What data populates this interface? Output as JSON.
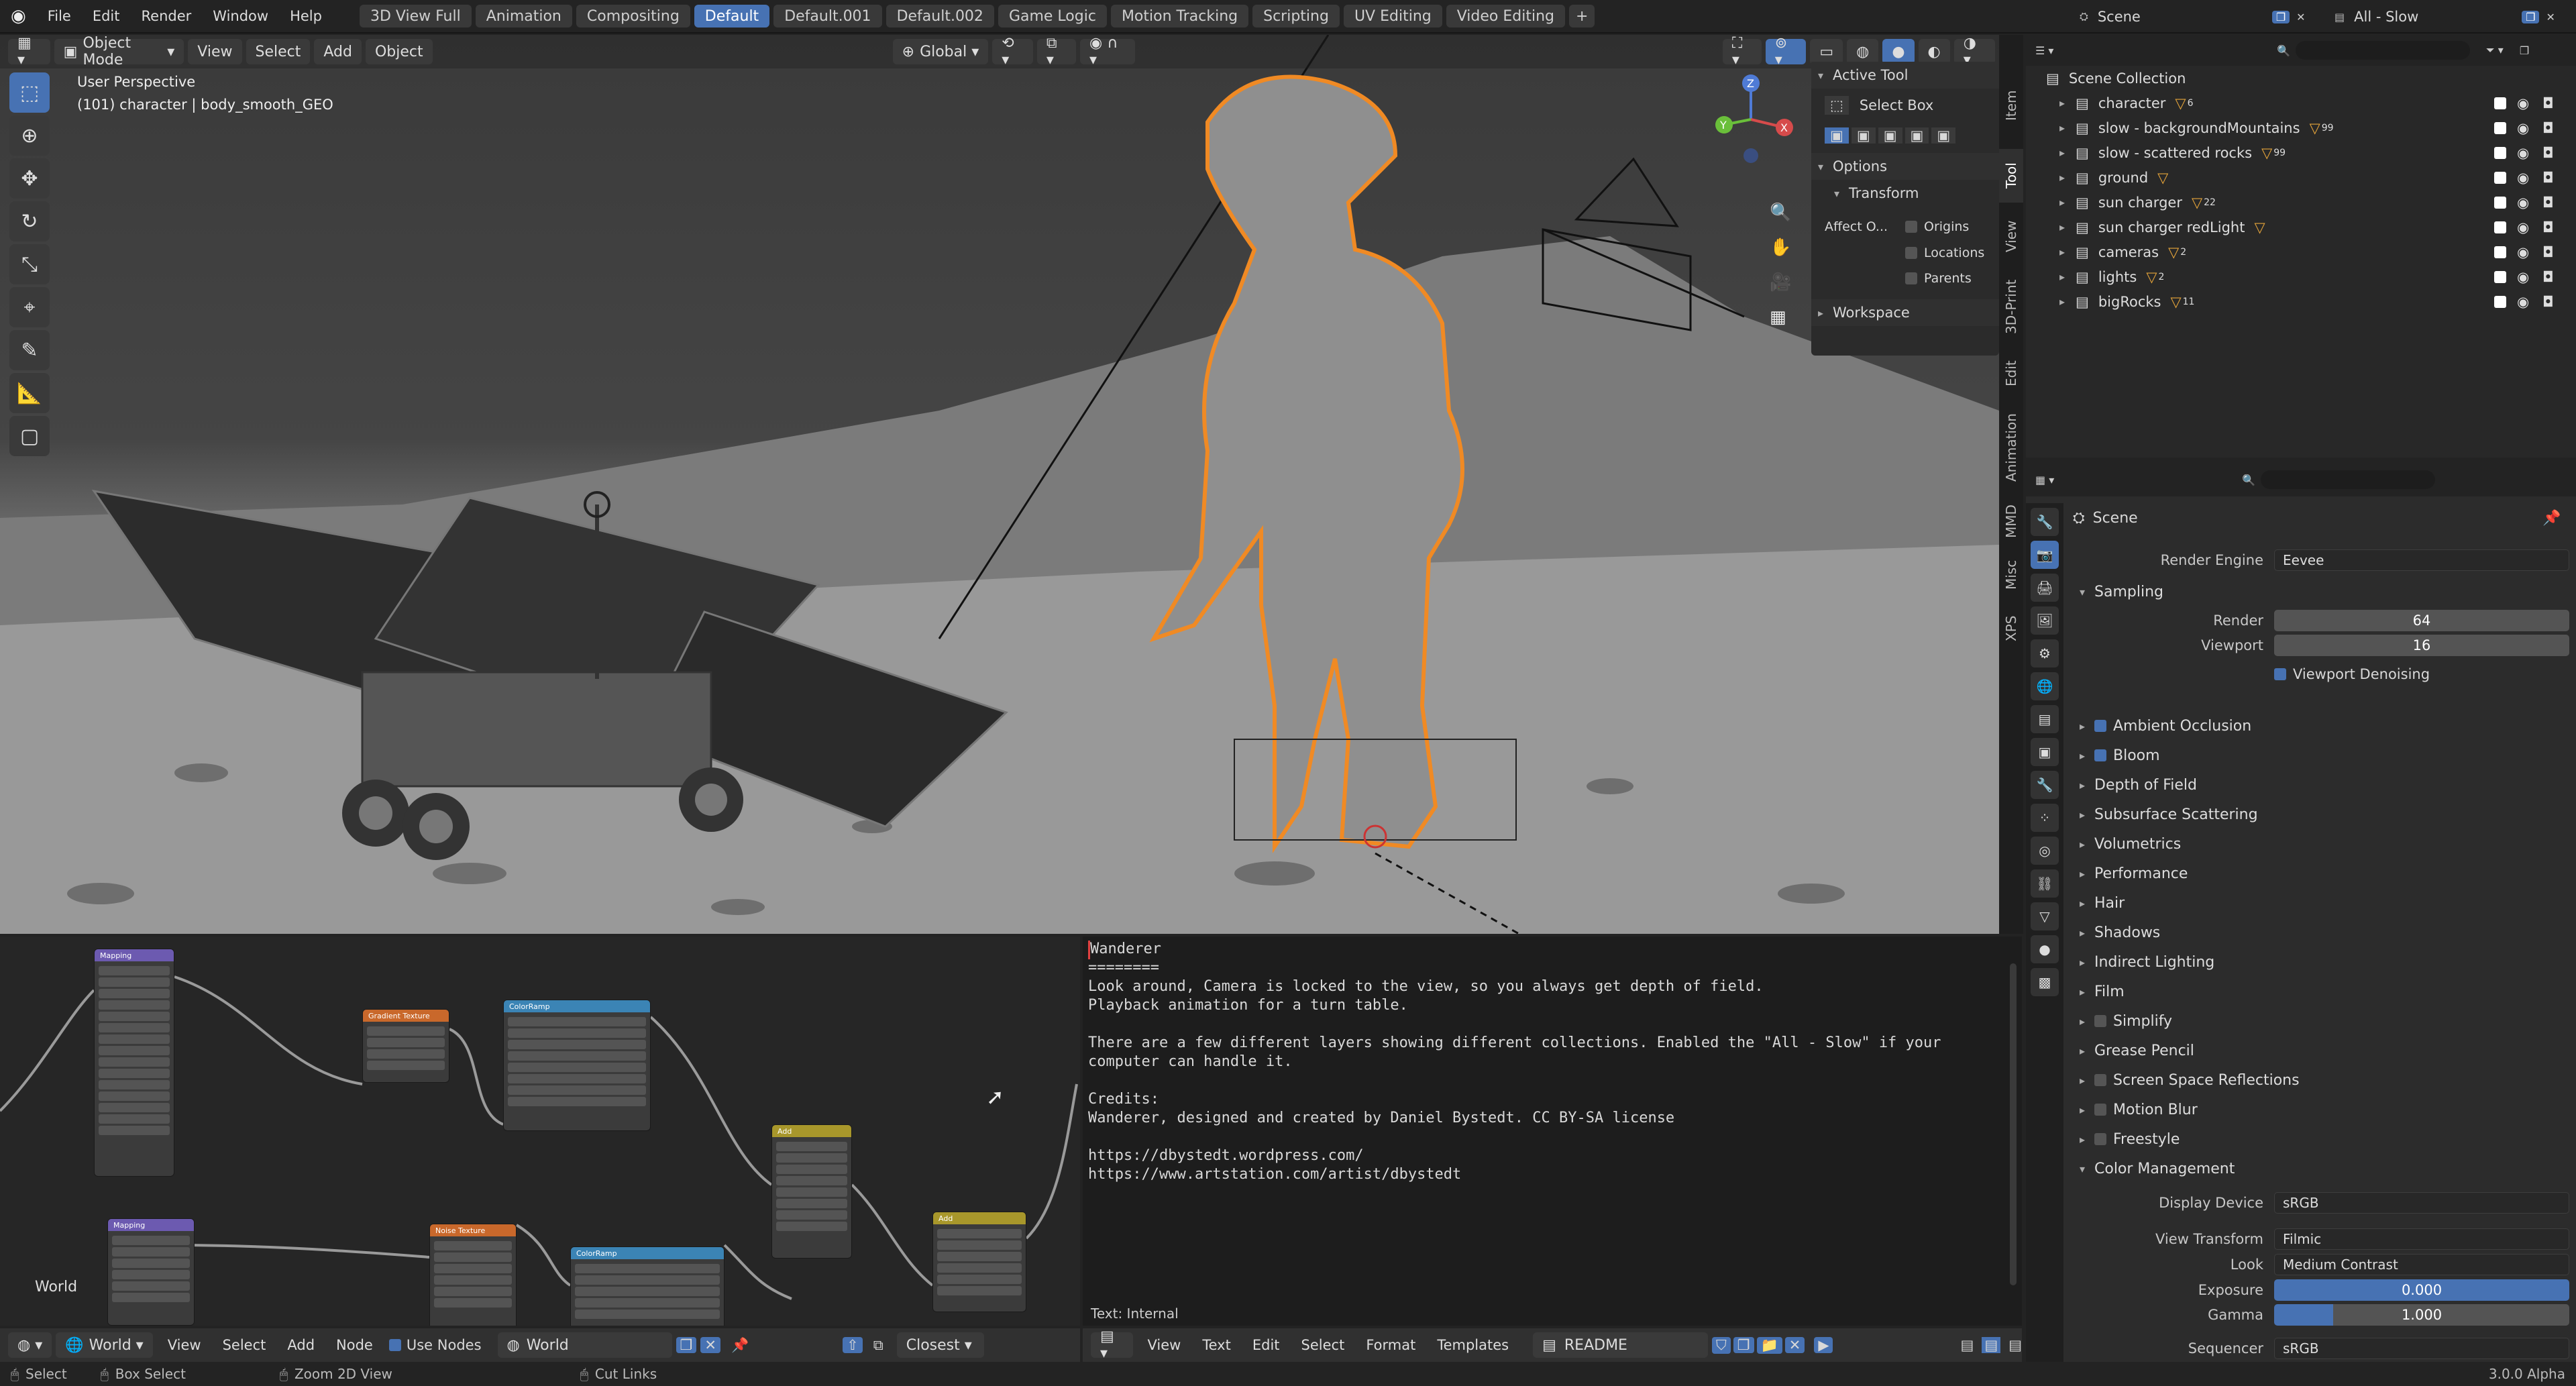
{
  "topbar": {
    "menus": [
      "File",
      "Edit",
      "Render",
      "Window",
      "Help"
    ],
    "workspaces": [
      "3D View Full",
      "Animation",
      "Compositing",
      "Default",
      "Default.001",
      "Default.002",
      "Game Logic",
      "Motion Tracking",
      "Scripting",
      "UV Editing",
      "Video Editing"
    ],
    "active_workspace": "Default",
    "scene": "Scene",
    "view_layer": "All - Slow"
  },
  "viewport": {
    "mode": "Object Mode",
    "menus": [
      "View",
      "Select",
      "Add",
      "Object"
    ],
    "orientation": "Global",
    "info_line1": "User Perspective",
    "info_line2": "(101) character | body_smooth_GEO",
    "gizmo_x": "X",
    "gizmo_y": "Y",
    "gizmo_z": "Z"
  },
  "npanel": {
    "active_tool_title": "Active Tool",
    "select_box": "Select Box",
    "options_title": "Options",
    "transform_title": "Transform",
    "affect_only": "Affect O...",
    "origins": "Origins",
    "locations": "Locations",
    "parents": "Parents",
    "workspace_title": "Workspace"
  },
  "side_tabs": [
    "Item",
    "Tool",
    "View",
    "3D-Print",
    "Edit",
    "Animation",
    "MMD",
    "Misc",
    "XPS"
  ],
  "outliner": {
    "root": "Scene Collection",
    "items": [
      {
        "name": "character",
        "badge": "6"
      },
      {
        "name": "slow - backgroundMountains",
        "badge": "99"
      },
      {
        "name": "slow - scattered rocks",
        "badge": "99"
      },
      {
        "name": "ground",
        "badge": ""
      },
      {
        "name": "sun charger",
        "badge": "22"
      },
      {
        "name": "sun charger redLight",
        "badge": ""
      },
      {
        "name": "cameras",
        "badge": "2"
      },
      {
        "name": "lights",
        "badge": "2"
      },
      {
        "name": "bigRocks",
        "badge": "11"
      }
    ]
  },
  "properties": {
    "context": "Scene",
    "render_engine_label": "Render Engine",
    "render_engine": "Eevee",
    "sampling": "Sampling",
    "render_label": "Render",
    "render_samples": "64",
    "viewport_label": "Viewport",
    "viewport_samples": "16",
    "viewport_denoising": "Viewport Denoising",
    "sections": [
      {
        "label": "Ambient Occlusion",
        "checkbox": true,
        "checked": true
      },
      {
        "label": "Bloom",
        "checkbox": true,
        "checked": true
      },
      {
        "label": "Depth of Field",
        "checkbox": false
      },
      {
        "label": "Subsurface Scattering",
        "checkbox": false
      },
      {
        "label": "Volumetrics",
        "checkbox": false
      },
      {
        "label": "Performance",
        "checkbox": false
      },
      {
        "label": "Hair",
        "checkbox": false
      },
      {
        "label": "Shadows",
        "checkbox": false
      },
      {
        "label": "Indirect Lighting",
        "checkbox": false
      },
      {
        "label": "Film",
        "checkbox": false
      },
      {
        "label": "Simplify",
        "checkbox": true,
        "checked": false
      },
      {
        "label": "Grease Pencil",
        "checkbox": false
      },
      {
        "label": "Screen Space Reflections",
        "checkbox": true,
        "checked": false
      },
      {
        "label": "Motion Blur",
        "checkbox": true,
        "checked": false
      },
      {
        "label": "Freestyle",
        "checkbox": true,
        "checked": false
      }
    ],
    "color_management": "Color Management",
    "display_device_label": "Display Device",
    "display_device": "sRGB",
    "view_transform_label": "View Transform",
    "view_transform": "Filmic",
    "look_label": "Look",
    "look": "Medium Contrast",
    "exposure_label": "Exposure",
    "exposure": "0.000",
    "gamma_label": "Gamma",
    "gamma": "1.000",
    "sequencer_label": "Sequencer",
    "sequencer": "sRGB"
  },
  "node_editor": {
    "world_label": "World",
    "header_type": "World",
    "menus": [
      "View",
      "Select",
      "Add",
      "Node"
    ],
    "use_nodes": "Use Nodes",
    "world_name": "World",
    "snap": "Closest",
    "nodes": [
      {
        "title": "Mapping",
        "color": "#6c5ab0"
      },
      {
        "title": "Gradient Texture",
        "color": "#c9682b"
      },
      {
        "title": "ColorRamp",
        "color": "#3b84b5"
      },
      {
        "title": "Add",
        "color": "#a8972b"
      },
      {
        "title": "Mapping",
        "color": "#6c5ab0"
      },
      {
        "title": "Noise Texture",
        "color": "#c9682b"
      },
      {
        "title": "ColorRamp",
        "color": "#3b84b5"
      },
      {
        "title": "Add",
        "color": "#a8972b"
      }
    ]
  },
  "text_editor": {
    "lines": [
      "Wanderer",
      "========",
      "Look around, Camera is locked to the view, so you always get depth of field.",
      "Playback animation for a turn table.",
      "",
      "There are a few different layers showing different collections. Enabled the \"All - Slow\" if your",
      "computer can handle it.",
      "",
      "Credits:",
      "Wanderer, designed and created by Daniel Bystedt. CC BY-SA license",
      "",
      "https://dbystedt.wordpress.com/",
      "https://www.artstation.com/artist/dbystedt"
    ],
    "footer": "Text: Internal",
    "menus": [
      "View",
      "Text",
      "Edit",
      "Select",
      "Format",
      "Templates"
    ],
    "file_name": "README"
  },
  "statusbar": {
    "select": "Select",
    "box_select": "Box Select",
    "zoom": "Zoom 2D View",
    "cut_links": "Cut Links",
    "version": "3.0.0 Alpha"
  },
  "colors": {
    "accent": "#4772b3",
    "selection_outline": "#f08a24",
    "background": "#232323"
  }
}
